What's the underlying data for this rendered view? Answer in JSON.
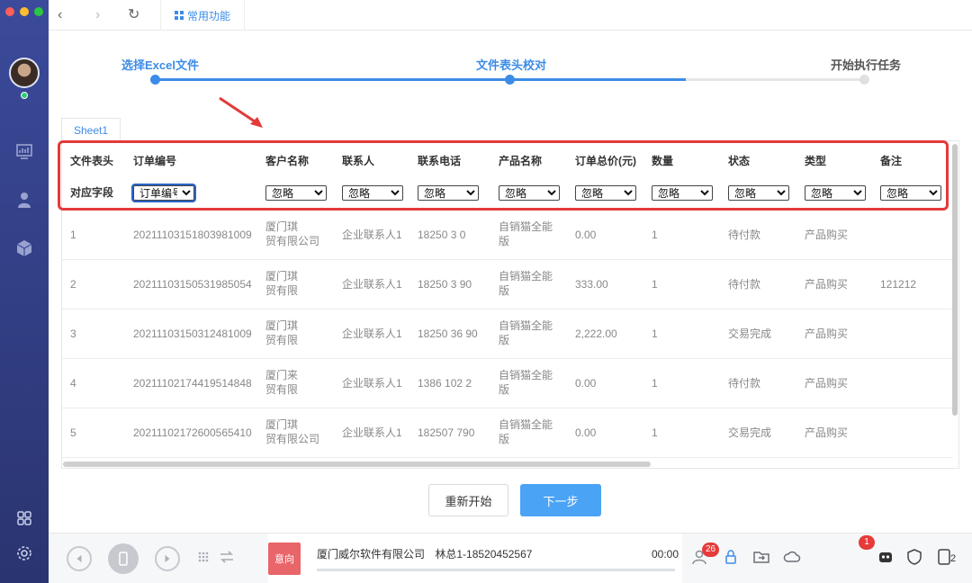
{
  "window": {
    "traffic_colors": [
      "#fe5f57",
      "#febc2e",
      "#28c840"
    ]
  },
  "topbar": {
    "back_icon": "chevron-left-icon",
    "forward_icon": "chevron-right-icon",
    "refresh_icon": "refresh-icon",
    "quick_tab_label": "常用功能"
  },
  "steps": {
    "items": [
      {
        "label": "选择Excel文件",
        "state": "done"
      },
      {
        "label": "文件表头校对",
        "state": "active"
      },
      {
        "label": "开始执行任务",
        "state": "pending"
      }
    ],
    "active_color": "#3c8ce7",
    "pending_color": "#e6e6e6"
  },
  "sheet": {
    "tab_label": "Sheet1",
    "header_row_label": "文件表头",
    "mapping_row_label": "对应字段",
    "columns": [
      "订单编号",
      "客户名称",
      "联系人",
      "联系电话",
      "产品名称",
      "订单总价(元)",
      "数量",
      "状态",
      "类型",
      "备注"
    ],
    "mappings": [
      "订单编号",
      "忽略",
      "忽略",
      "忽略",
      "忽略",
      "忽略",
      "忽略",
      "忽略",
      "忽略",
      "忽略"
    ],
    "rows": [
      {
        "idx": "1",
        "order": "20211103151803981009",
        "customer": [
          "厦门琪",
          "贸有限公司"
        ],
        "contact": "企业联系人1",
        "phone": "18250 3 0",
        "product": [
          "自销猫全能",
          "版"
        ],
        "total": "0.00",
        "qty": "1",
        "status": "待付款",
        "type": "产品购买",
        "remark": ""
      },
      {
        "idx": "2",
        "order": "20211103150531985054",
        "customer": [
          "厦门琪",
          "贸有限"
        ],
        "contact": "企业联系人1",
        "phone": "18250 3 90",
        "product": [
          "自销猫全能",
          "版"
        ],
        "total": "333.00",
        "qty": "1",
        "status": "待付款",
        "type": "产品购买",
        "remark": "121212"
      },
      {
        "idx": "3",
        "order": "20211103150312481009",
        "customer": [
          "厦门琪",
          "贸有限"
        ],
        "contact": "企业联系人1",
        "phone": "18250 36 90",
        "product": [
          "自销猫全能",
          "版"
        ],
        "total": "2,222.00",
        "qty": "1",
        "status": "交易完成",
        "type": "产品购买",
        "remark": ""
      },
      {
        "idx": "4",
        "order": "20211102174419514848",
        "customer": [
          "厦门来",
          "贸有限"
        ],
        "contact": "企业联系人1",
        "phone": "1386 102 2",
        "product": [
          "自销猫全能",
          "版"
        ],
        "total": "0.00",
        "qty": "1",
        "status": "待付款",
        "type": "产品购买",
        "remark": ""
      },
      {
        "idx": "5",
        "order": "20211102172600565410",
        "customer": [
          "厦门琪",
          "贸有限公司"
        ],
        "contact": "企业联系人1",
        "phone": "182507 790",
        "product": [
          "自销猫全能",
          "版"
        ],
        "total": "0.00",
        "qty": "1",
        "status": "交易完成",
        "type": "产品购买",
        "remark": ""
      }
    ]
  },
  "buttons": {
    "restart": "重新开始",
    "next": "下一步"
  },
  "callbar": {
    "intent": "意向",
    "company": "厦门威尔软件有限公司",
    "contact": "林总1-18520452567",
    "time": "00:00",
    "contacts_badge": "26",
    "robot_badge": "1",
    "line_count": "2"
  },
  "sidebar": {
    "icons": [
      "dashboard-icon",
      "user-icon",
      "cube-icon",
      "apps-icon",
      "settings-icon"
    ]
  }
}
